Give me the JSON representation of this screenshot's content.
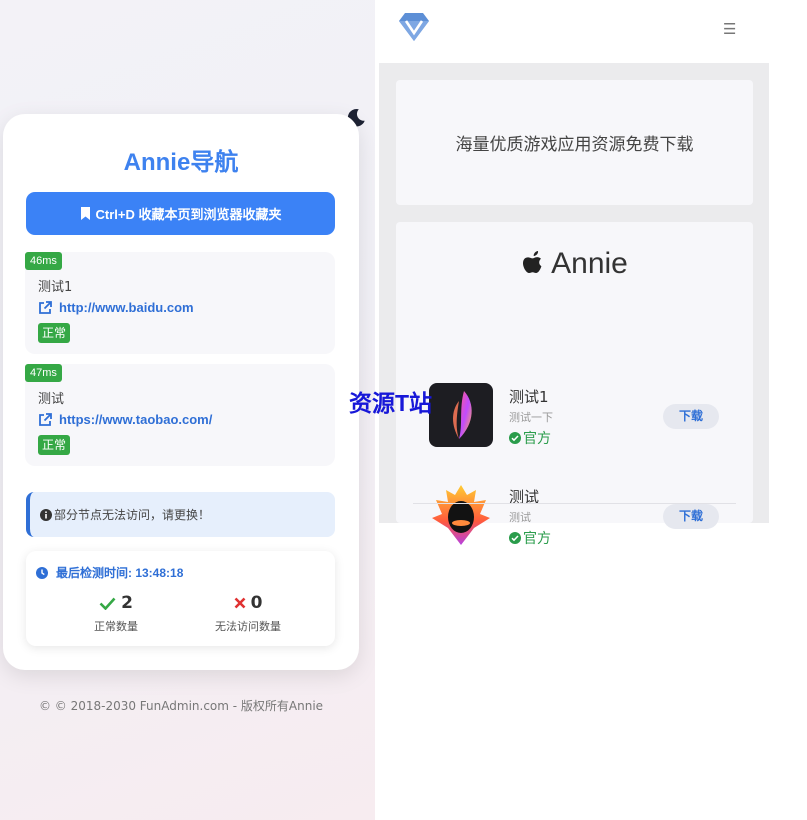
{
  "left_panel": {
    "title": "Annie导航",
    "bookmark_label": "Ctrl+D 收藏本页到浏览器收藏夹",
    "nodes": [
      {
        "latency": "46ms",
        "name": "测试1",
        "url": "http://www.baidu.com",
        "status": "正常"
      },
      {
        "latency": "47ms",
        "name": "测试",
        "url": "https://www.taobao.com/",
        "status": "正常"
      }
    ],
    "alert_text": "部分节点无法访问，请更换！",
    "last_check_label": "最后检测时间: 13:48:18",
    "stats": {
      "ok_count": "2",
      "ok_label": "正常数量",
      "fail_count": "0",
      "fail_label": "无法访问数量"
    },
    "footer": "© © 2018-2030 FunAdmin.com - 版权所有Annie"
  },
  "right_panel": {
    "banner_text": "海量优质游戏应用资源免费下载",
    "brand_name": "Annie",
    "apps": [
      {
        "name": "测试1",
        "desc": "测试一下",
        "official_label": "官方",
        "download_label": "下载"
      },
      {
        "name": "测试",
        "desc": "测试",
        "official_label": "官方",
        "download_label": "下载"
      }
    ]
  },
  "watermark": {
    "text": "资源T站"
  },
  "colors": {
    "accent": "#3b82f6",
    "success": "#35a845",
    "link": "#2f6fd6",
    "official": "#2a9c4b",
    "danger": "#e03131"
  }
}
